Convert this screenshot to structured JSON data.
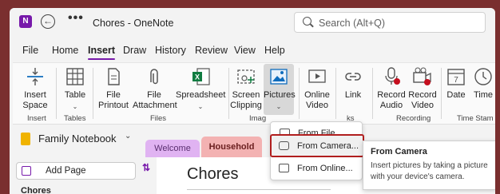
{
  "titlebar": {
    "app_icon": "N",
    "more": "•••",
    "title": "Chores  -  OneNote",
    "search_placeholder": "Search (Alt+Q)"
  },
  "menu": [
    "File",
    "Home",
    "Insert",
    "Draw",
    "History",
    "Review",
    "View",
    "Help"
  ],
  "menu_active": "Insert",
  "ribbon": {
    "insert_space": [
      "Insert",
      "Space"
    ],
    "table": "Table",
    "file_printout": [
      "File",
      "Printout"
    ],
    "file_attachment": [
      "File",
      "Attachment"
    ],
    "spreadsheet": "Spreadsheet",
    "screen_clipping": [
      "Screen",
      "Clipping"
    ],
    "pictures": "Pictures",
    "online_video": [
      "Online",
      "Video"
    ],
    "link": "Link",
    "record_audio": [
      "Record",
      "Audio"
    ],
    "record_video": [
      "Record",
      "Video"
    ],
    "date": "Date",
    "time": "Time",
    "groups": {
      "insert": "Insert",
      "tables": "Tables",
      "files": "Files",
      "images_partial": "Imag",
      "links_partial": "ks",
      "recording": "Recording",
      "time_stamp": "Time Stam"
    }
  },
  "dropdown": {
    "items": [
      "From File...",
      "From Camera...",
      "From Online..."
    ],
    "highlighted": "From Camera..."
  },
  "tooltip": {
    "title": "From Camera",
    "body": "Insert pictures by taking a picture with your device's camera."
  },
  "notebook": {
    "name": "Family Notebook"
  },
  "sections": [
    "Welcome",
    "Household"
  ],
  "pages": {
    "add_label": "Add Page",
    "items": [
      "Chores"
    ]
  },
  "page": {
    "title": "Chores"
  },
  "colors": {
    "accent": "#7719aa",
    "highlight_border": "#b01e1e",
    "welcome_tab": "#e0b3f2",
    "household_tab": "#f3b2b2",
    "notebook_icon": "#f0b300"
  },
  "icons": [
    "onenote-app-icon",
    "back-icon",
    "more-icon",
    "search-icon",
    "insert-space-icon",
    "table-icon",
    "file-printout-icon",
    "file-attachment-icon",
    "spreadsheet-icon",
    "screen-clipping-icon",
    "pictures-icon",
    "online-video-icon",
    "link-icon",
    "record-audio-icon",
    "record-video-icon",
    "date-icon",
    "time-icon",
    "image-file-icon",
    "camera-icon",
    "online-picture-icon",
    "notebook-icon",
    "add-page-icon",
    "sort-icon"
  ]
}
